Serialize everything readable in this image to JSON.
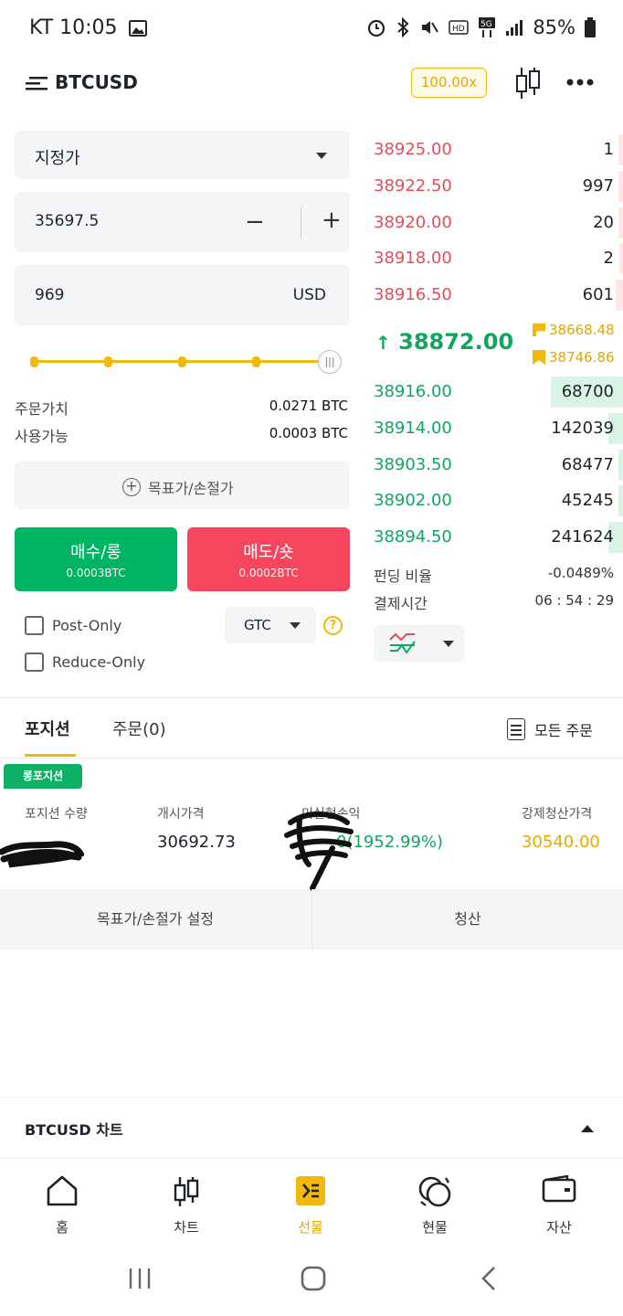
{
  "status_bar": {
    "carrier_time": "KT 10:05",
    "battery": "85%",
    "icons": [
      "gallery-icon",
      "alarm-icon",
      "bluetooth-icon",
      "mute-icon",
      "hd-icon",
      "5g-icon",
      "signal-icon",
      "battery-icon"
    ]
  },
  "header": {
    "symbol": "BTCUSD",
    "leverage": "100.00x"
  },
  "form": {
    "order_type": "지정가",
    "price": "35697.5",
    "quantity": "969",
    "quantity_unit": "USD",
    "slider_percent": 100,
    "order_value_label": "주문가치",
    "order_value": "0.0271 BTC",
    "available_label": "사용가능",
    "available": "0.0003 BTC",
    "tpsl_label": "목표가/손절가",
    "buy_label": "매수/롱",
    "buy_sub": "0.0003BTC",
    "sell_label": "매도/숏",
    "sell_sub": "0.0002BTC",
    "post_only": "Post-Only",
    "reduce_only": "Reduce-Only",
    "tif": "GTC"
  },
  "orderbook": {
    "asks": [
      {
        "price": "38925.00",
        "qty": "1",
        "depth": 0.02
      },
      {
        "price": "38922.50",
        "qty": "997",
        "depth": 0.02
      },
      {
        "price": "38920.00",
        "qty": "20",
        "depth": 0.02
      },
      {
        "price": "38918.00",
        "qty": "2",
        "depth": 0.01
      },
      {
        "price": "38916.50",
        "qty": "601",
        "depth": 0.03
      }
    ],
    "last_price": "38872.00",
    "mark_price": "38668.48",
    "index_price": "38746.86",
    "bids": [
      {
        "price": "38916.00",
        "qty": "68700",
        "depth": 0.29
      },
      {
        "price": "38914.00",
        "qty": "142039",
        "depth": 0.06
      },
      {
        "price": "38903.50",
        "qty": "68477",
        "depth": 0.02
      },
      {
        "price": "38902.00",
        "qty": "45245",
        "depth": 0.02
      },
      {
        "price": "38894.50",
        "qty": "241624",
        "depth": 0.06
      }
    ],
    "funding_label": "펀딩 비율",
    "funding_value": "-0.0489%",
    "settle_label": "결제시간",
    "settle_value": "06 : 54 : 29"
  },
  "positions": {
    "tab_positions": "포지션",
    "tab_orders": "주문(0)",
    "all_orders": "모든 주문",
    "badge": "롱포지션",
    "col_size": "포지션 수량",
    "col_entry": "개시가격",
    "col_pnl": "미실현손익",
    "col_liq": "강제청산가격",
    "entry_price": "30692.73",
    "pnl_visible": "0(1952.99%)",
    "liq_price": "30540.00",
    "btn_tpsl": "목표가/손절가 설정",
    "btn_close": "청산"
  },
  "chart_section": {
    "title": "BTCUSD 차트"
  },
  "bottom_nav": [
    {
      "label": "홈",
      "icon": "home-icon"
    },
    {
      "label": "차트",
      "icon": "candlestick-icon"
    },
    {
      "label": "선물",
      "icon": "futures-icon"
    },
    {
      "label": "현물",
      "icon": "spot-icon"
    },
    {
      "label": "자산",
      "icon": "wallet-icon"
    }
  ],
  "colors": {
    "accent": "#f0b90b",
    "buy": "#00b464",
    "sell": "#f6465d"
  }
}
